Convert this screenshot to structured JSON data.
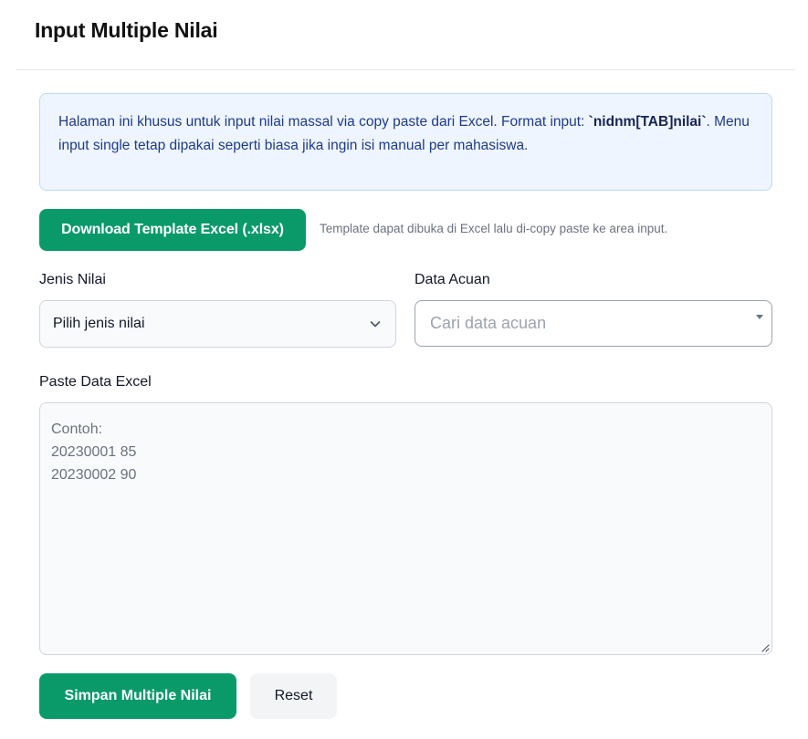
{
  "header": {
    "title": "Input Multiple Nilai"
  },
  "info": {
    "text_before": "Halaman ini khusus untuk input nilai massal via copy paste dari Excel. Format input: ",
    "format_code": "`nidnm[TAB]nilai`",
    "text_after": ". Menu input single tetap dipakai seperti biasa jika ingin isi manual per mahasiswa."
  },
  "download": {
    "button_label": "Download Template Excel (.xlsx)",
    "hint": "Template dapat dibuka di Excel lalu di-copy paste ke area input."
  },
  "form": {
    "jenis_nilai": {
      "label": "Jenis Nilai",
      "selected": "Pilih jenis nilai",
      "icon": "chevron-down-icon"
    },
    "data_acuan": {
      "label": "Data Acuan",
      "placeholder": "Cari data acuan",
      "icon": "caret-down-icon"
    },
    "paste": {
      "label": "Paste Data Excel",
      "placeholder": "Contoh:\n20230001 85\n20230002 90"
    }
  },
  "actions": {
    "save_label": "Simpan Multiple Nilai",
    "reset_label": "Reset"
  },
  "colors": {
    "primary": "#0a9a6a",
    "info_bg": "#eef5ff",
    "info_border": "#bfd7f5",
    "info_text": "#1e3a8a"
  }
}
